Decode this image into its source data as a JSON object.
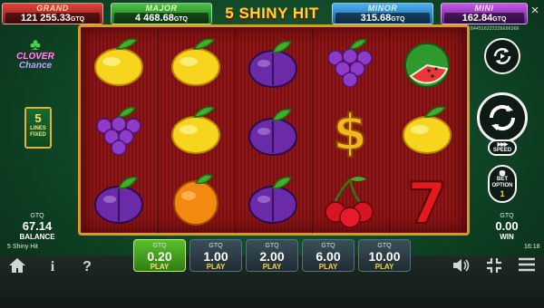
{
  "jackpots": {
    "grand": {
      "label": "GRAND",
      "value": "121 255.33",
      "currency": "GTQ"
    },
    "major": {
      "label": "MAJOR",
      "value": "4 468.68",
      "currency": "GTQ"
    },
    "minor": {
      "label": "MINOR",
      "value": "315.68",
      "currency": "GTQ"
    },
    "mini": {
      "label": "MINI",
      "value": "162.84",
      "currency": "GTQ"
    }
  },
  "game_title": "5 SHINY HIT",
  "close_icon": "×",
  "logo": {
    "line1": "CLOVER",
    "line2": "Chance"
  },
  "lines": {
    "count": "5",
    "line_a": "LINES",
    "line_b": "FIXED"
  },
  "balance": {
    "currency": "GTQ",
    "value": "67.14",
    "label": "BALANCE"
  },
  "win": {
    "currency": "GTQ",
    "value": "0.00",
    "label": "WIN"
  },
  "serial": "844516222226696366",
  "reels": [
    [
      "lemon",
      "grapes",
      "plum"
    ],
    [
      "lemon",
      "lemon",
      "orange"
    ],
    [
      "plum",
      "plum",
      "plum"
    ],
    [
      "grapes",
      "dollar",
      "cherry"
    ],
    [
      "watermelon",
      "lemon",
      "seven"
    ]
  ],
  "controls": {
    "speed_label": "SPEED",
    "bet_option_label_a": "BET",
    "bet_option_label_b": "OPTION",
    "bet_option_value": "1"
  },
  "status": {
    "game_name": "5 Shiny Hit",
    "time": "16:18"
  },
  "bets": [
    {
      "currency": "GTQ",
      "value": "0.20",
      "action": "PLAY",
      "active": true
    },
    {
      "currency": "GTQ",
      "value": "1.00",
      "action": "PLAY",
      "active": false
    },
    {
      "currency": "GTQ",
      "value": "2.00",
      "action": "PLAY",
      "active": false
    },
    {
      "currency": "GTQ",
      "value": "6.00",
      "action": "PLAY",
      "active": false
    },
    {
      "currency": "GTQ",
      "value": "10.00",
      "action": "PLAY",
      "active": false
    }
  ],
  "bottom_icons": {
    "home": "home-icon",
    "info": "i",
    "help": "?",
    "sound": "speaker-icon",
    "fullscreen": "fullscreen-icon",
    "menu": "menu-icon"
  },
  "colors": {
    "frame": "#d89a1f",
    "reel_bg": "#7a1012",
    "active_bet": "#4aa824",
    "accent": "#ffd33a"
  }
}
